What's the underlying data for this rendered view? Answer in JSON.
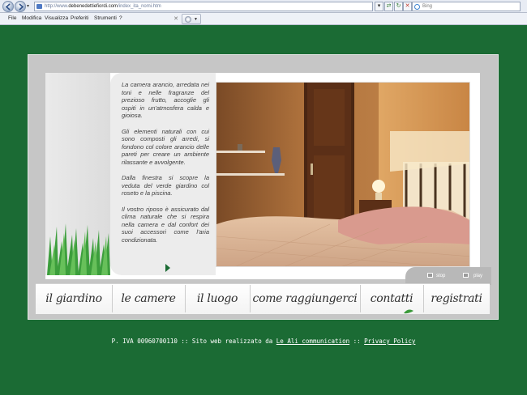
{
  "browser": {
    "url_prefix": "http://www.",
    "url_domain": "debenedettiefiordi.com",
    "url_path": "/index_ita_nomi.htm",
    "search_placeholder": "Bing",
    "menu": [
      "File",
      "Modifica",
      "Visualizza",
      "Preferiti",
      "Strumenti",
      "?"
    ]
  },
  "room": {
    "paragraphs": [
      "La camera arancio, arredata nei toni e nelle fragranze del prezioso frutto, accoglie gli ospiti in un'atmosfera calda e gioiosa.",
      "Gli elementi naturali con cui sono composti gli arredi, si fondono col colore arancio delle pareti per creare un ambiente rilassante e avvolgente.",
      "Dalla finestra si scopre la veduta del verde giardino col roseto e la piscina.",
      "Il vostro riposo è assicurato dal clima naturale che si respira nella camera e dal confort dei suoi accessori come l'aria condizionata."
    ]
  },
  "slideshow": {
    "stop_label": "stop",
    "play_label": "play"
  },
  "nav": {
    "items": [
      "il giardino",
      "le camere",
      "il luogo",
      "come raggiungerci",
      "contatti",
      "registrati"
    ]
  },
  "footer": {
    "prefix": "P. IVA 00960700110 :: Sito web realizzato da ",
    "agency_link": "Le Ali communication",
    "separator": " :: ",
    "privacy_link": "Privacy Policy"
  },
  "colors": {
    "page_background": "#1b6b34",
    "frame_gray": "#c6c6c6",
    "wall_orange": "#c88a4c",
    "bedspread_pink": "#d9a294"
  }
}
